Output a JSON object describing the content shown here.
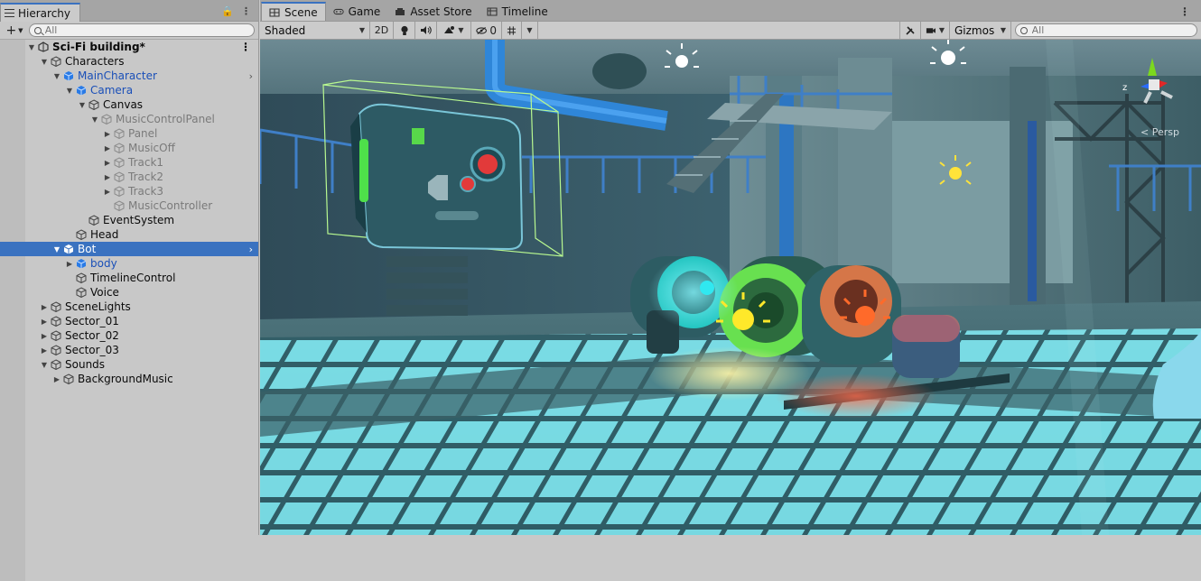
{
  "hierarchy": {
    "tab_label": "Hierarchy",
    "search_placeholder": "All",
    "add_label": "+",
    "scene_name": "Sci-Fi building*",
    "rows": [
      {
        "label": "Characters",
        "depth": 1,
        "arrow": "down",
        "type": "normal"
      },
      {
        "label": "MainCharacter",
        "depth": 2,
        "arrow": "down",
        "type": "prefab",
        "chevron": true
      },
      {
        "label": "Camera",
        "depth": 3,
        "arrow": "down",
        "type": "prefab"
      },
      {
        "label": "Canvas",
        "depth": 4,
        "arrow": "down",
        "type": "normal"
      },
      {
        "label": "MusicControlPanel",
        "depth": 5,
        "arrow": "down",
        "type": "disabled"
      },
      {
        "label": "Panel",
        "depth": 6,
        "arrow": "right",
        "type": "disabled"
      },
      {
        "label": "MusicOff",
        "depth": 6,
        "arrow": "right",
        "type": "disabled"
      },
      {
        "label": "Track1",
        "depth": 6,
        "arrow": "right",
        "type": "disabled"
      },
      {
        "label": "Track2",
        "depth": 6,
        "arrow": "right",
        "type": "disabled"
      },
      {
        "label": "Track3",
        "depth": 6,
        "arrow": "right",
        "type": "disabled"
      },
      {
        "label": "MusicController",
        "depth": 6,
        "arrow": "none",
        "type": "disabled"
      },
      {
        "label": "EventSystem",
        "depth": 4,
        "arrow": "none",
        "type": "normal"
      },
      {
        "label": "Head",
        "depth": 3,
        "arrow": "none",
        "type": "normal"
      },
      {
        "label": "Bot",
        "depth": 2,
        "arrow": "down",
        "type": "prefab",
        "selected": true,
        "chevron": true
      },
      {
        "label": "body",
        "depth": 3,
        "arrow": "right",
        "type": "prefab"
      },
      {
        "label": "TimelineControl",
        "depth": 3,
        "arrow": "none",
        "type": "normal"
      },
      {
        "label": "Voice",
        "depth": 3,
        "arrow": "none",
        "type": "normal"
      },
      {
        "label": "SceneLights",
        "depth": 1,
        "arrow": "right",
        "type": "normal"
      },
      {
        "label": "Sector_01",
        "depth": 1,
        "arrow": "right",
        "type": "normal"
      },
      {
        "label": "Sector_02",
        "depth": 1,
        "arrow": "right",
        "type": "normal"
      },
      {
        "label": "Sector_03",
        "depth": 1,
        "arrow": "right",
        "type": "normal"
      },
      {
        "label": "Sounds",
        "depth": 1,
        "arrow": "down",
        "type": "normal"
      },
      {
        "label": "BackgroundMusic",
        "depth": 2,
        "arrow": "right",
        "type": "normal"
      }
    ]
  },
  "scene_tabs": [
    {
      "label": "Scene",
      "icon": "grid-icon",
      "active": true
    },
    {
      "label": "Game",
      "icon": "gamepad-icon",
      "active": false
    },
    {
      "label": "Asset Store",
      "icon": "store-icon",
      "active": false
    },
    {
      "label": "Timeline",
      "icon": "timeline-icon",
      "active": false
    }
  ],
  "scene_toolbar": {
    "draw_mode": "Shaded",
    "mode_2d": "2D",
    "hidden_count": "0",
    "gizmos_label": "Gizmos",
    "search_placeholder": "All"
  },
  "viewport": {
    "projection_label": "< Persp"
  },
  "colors": {
    "selection": "#3a72c0",
    "prefab_text": "#1a4fb8",
    "panel_bg": "#c8c8c8"
  }
}
